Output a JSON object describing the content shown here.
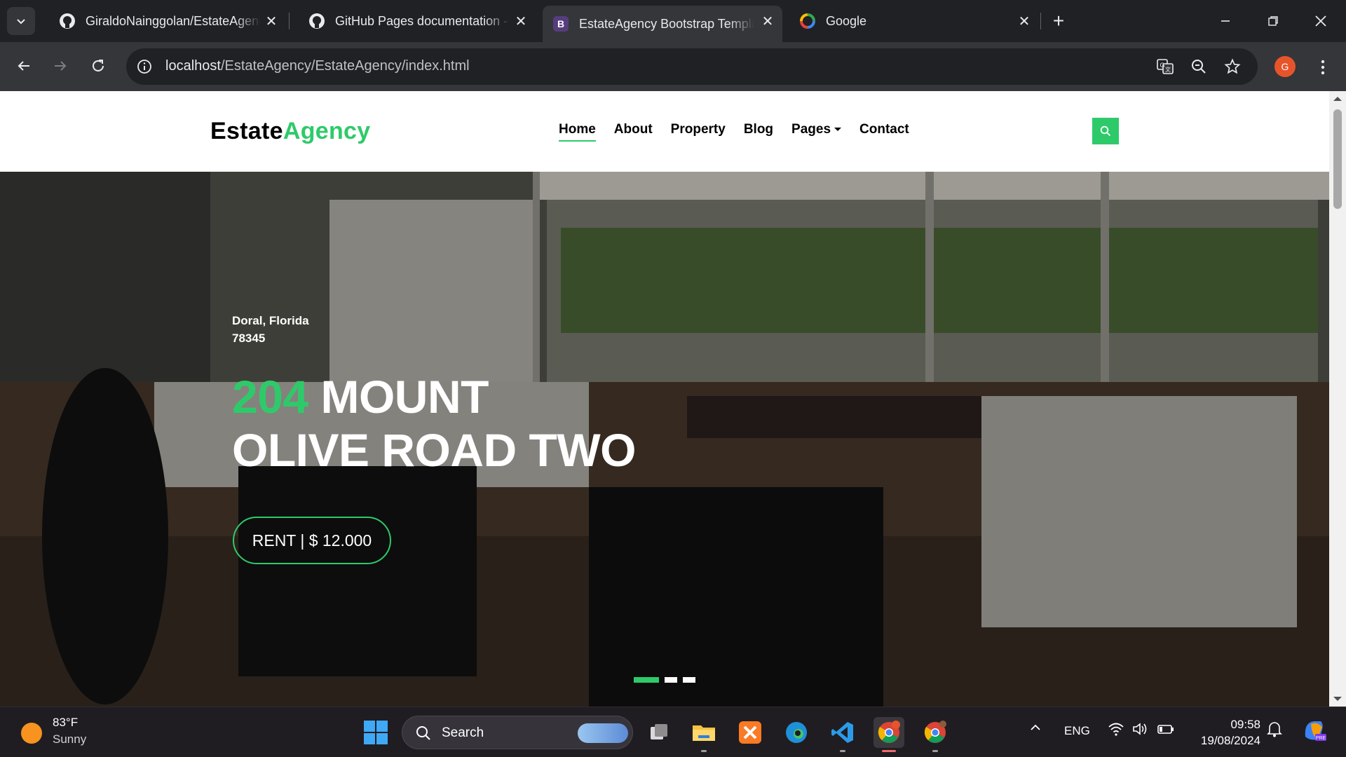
{
  "browser": {
    "tabs": [
      {
        "title": "GiraldoNainggolan/EstateAgency",
        "favicon": "github-icon",
        "active": false
      },
      {
        "title": "GitHub Pages documentation - GitHub Docs",
        "favicon": "github-icon",
        "active": false
      },
      {
        "title": "EstateAgency Bootstrap Template",
        "favicon": "bootstrap-icon",
        "active": true
      },
      {
        "title": "Google",
        "favicon": "google-icon",
        "active": false
      }
    ],
    "url_host": "localhost",
    "url_path": "/EstateAgency/EstateAgency/index.html",
    "profile_initial": "G"
  },
  "site": {
    "logo_primary": "Estate",
    "logo_accent": "Agency",
    "nav": [
      {
        "label": "Home",
        "active": true
      },
      {
        "label": "About",
        "active": false
      },
      {
        "label": "Property",
        "active": false
      },
      {
        "label": "Blog",
        "active": false
      },
      {
        "label": "Pages",
        "active": false,
        "dropdown": true
      },
      {
        "label": "Contact",
        "active": false
      }
    ],
    "accent_color": "#2eca6a",
    "hero": {
      "location_line1": "Doral, Florida",
      "location_line2": "78345",
      "title_number": "204",
      "title_line1_rest": " MOUNT",
      "title_line2": "OLIVE ROAD TWO",
      "price_button": "RENT | $ 12.000",
      "slides_total": 3,
      "slide_active": 1
    }
  },
  "taskbar": {
    "weather_temp": "83°F",
    "weather_desc": "Sunny",
    "search_label": "Search",
    "language": "ENG",
    "time": "09:58",
    "date": "19/08/2024"
  }
}
